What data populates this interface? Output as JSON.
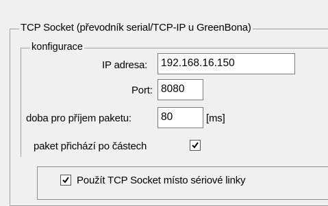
{
  "group": {
    "title": "TCP Socket (převodník serial/TCP-IP u GreenBona)",
    "config": {
      "title": "konfigurace",
      "ip_label": "IP adresa:",
      "ip_value": "192.168.16.150",
      "port_label": "Port:",
      "port_value": "8080",
      "packet_time_label": "doba pro příjem paketu:",
      "packet_time_value": "80",
      "packet_time_unit": "[ms]",
      "packet_parts_label": "paket přichází po částech",
      "packet_parts_checked": true
    },
    "use_tcp": {
      "label": "Použít TCP Socket místo sériové linky",
      "checked": true
    }
  }
}
